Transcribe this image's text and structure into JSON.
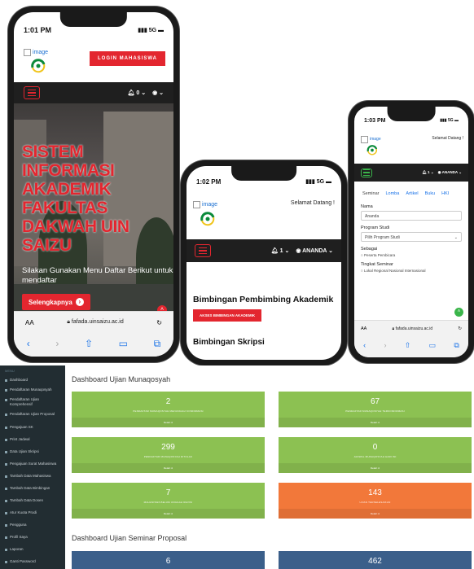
{
  "colors": {
    "primary_red": "#e3262f",
    "navbar_dark": "#1f1f1f",
    "sidebar_dark": "#222d32",
    "box_green": "#8cc152",
    "box_orange": "#f2783a",
    "box_blue": "#3b5f8a",
    "link_blue": "#1a73e8"
  },
  "phone1": {
    "time": "1:01 PM",
    "signal": "5G",
    "broken_image_alt": "image",
    "login_label": "LOGIN MAHASISWA",
    "bell_label": "0",
    "hero_title": "SISTEM INFORMASI AKADEMIK FAKULTAS DAKWAH UIN SAIZU",
    "hero_sub": "Silakan Gunakan Menu Daftar Berikut untuk mendaftar",
    "more_label": "Selengkapnya",
    "font_size_label": "AA",
    "url": "fafada.uinsaizu.ac.id"
  },
  "phone2": {
    "time": "1:02 PM",
    "signal": "5G",
    "broken_image_alt": "image",
    "welcome": "Selamat Datang !",
    "bell_label": "1",
    "user_label": "ANANDA",
    "heading1": "Bimbingan Pembimbing Akademik",
    "button_label": "AKSES BIMBINGAN AKADEMIK",
    "heading2": "Bimbingan Skripsi"
  },
  "phone3": {
    "time": "1:03 PM",
    "signal": "5G",
    "broken_image_alt": "image",
    "welcome": "Selamat Datang !",
    "bell_label": "1",
    "user_label": "ANANDA",
    "tabs": [
      "Seminar",
      "Lomba",
      "Artikel",
      "Buku",
      "HKI"
    ],
    "nama_label": "Nama",
    "nama_value": "Ananda",
    "prodi_label": "Program Studi",
    "prodi_value": "Pilih Program Studi",
    "sebagai_label": "Sebagai",
    "sebagai_options": "Peserta  Pembicara",
    "tingkat_label": "Tingkat Seminar",
    "tingkat_options": "Lokal  Regional  Nasional  Internasional",
    "font_size_label": "AA",
    "url": "fafada.uinsaizu.ac.id"
  },
  "dashboard": {
    "sidebar_head": "MENU",
    "sidebar_items": [
      "Dashboard",
      "Pendaftaran Munaqosyah",
      "Pendaftaran Ujian Komprehensif",
      "Pendaftaran Ujian Proposal",
      "Pengajuan SK",
      "Print Jadwal",
      "Data Ujian Skripsi",
      "Pengajuan Surat Mahasiswa",
      "Tambah Data Mahasiswa",
      "Tambah Data Bimbingan",
      "Tambah Data Dosen",
      "Atur Kuota Prodi",
      "Pengguna",
      "Profil Saya",
      "Laporan",
      "Ganti Password"
    ],
    "section1_title": "Dashboard Ujian Munaqosyah",
    "boxes1": [
      {
        "value": "2",
        "caption": "PENDAFTAR MUNAQOSYAH MENUNGGU KONFIRMASI",
        "foot": "Detail"
      },
      {
        "value": "67",
        "caption": "PENDAFTAR MUNAQOSYAH TERKONFIRMASI",
        "foot": "Detail"
      },
      {
        "value": "299",
        "caption": "PENDAFTAR MUNAQOSYAH DITOLAK",
        "foot": "Detail"
      },
      {
        "value": "0",
        "caption": "JADWAL MUNAQOSYAH HARI INI",
        "foot": "Detail"
      },
      {
        "value": "7",
        "caption": "MAHASISWA BELUM UNGGAH REVISI",
        "foot": "Detail"
      },
      {
        "value": "143",
        "caption": "UJIAN TERSELESAIKAN",
        "foot": "Detail"
      }
    ],
    "section2_title": "Dashboard Ujian Seminar Proposal",
    "boxes2": [
      {
        "value": "6"
      },
      {
        "value": "462"
      }
    ]
  }
}
